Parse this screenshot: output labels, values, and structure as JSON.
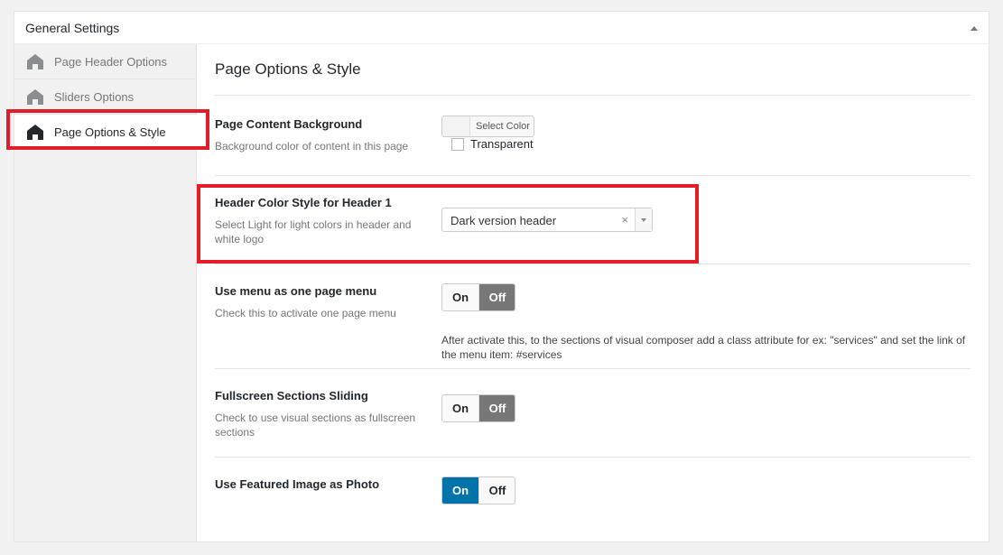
{
  "panel": {
    "title": "General Settings"
  },
  "sidebar": {
    "items": [
      {
        "label": "Page Header Options"
      },
      {
        "label": "Sliders Options"
      },
      {
        "label": "Page Options & Style"
      }
    ]
  },
  "content": {
    "title": "Page Options & Style",
    "background": {
      "title": "Page Content Background",
      "desc": "Background color of content in this page",
      "button_label": "Select Color",
      "transparent_label": "Transparent"
    },
    "header_color": {
      "title": "Header Color Style for Header 1",
      "desc": "Select Light for light colors in header and white logo",
      "selected": "Dark version header",
      "clear": "×"
    },
    "one_page_menu": {
      "title": "Use menu as one page menu",
      "desc": "Check this to activate one page menu",
      "on": "On",
      "off": "Off",
      "note": "After activate this, to the sections of visual composer add a class attribute for ex: \"services\" and set the link of the menu item: #services"
    },
    "fullscreen": {
      "title": "Fullscreen Sections Sliding",
      "desc": "Check to use visual sections as fullscreen sections",
      "on": "On",
      "off": "Off"
    },
    "featured_image": {
      "title": "Use Featured Image as Photo",
      "on": "On",
      "off": "Off"
    }
  },
  "colors": {
    "highlight": "#e11d2a",
    "switch_on_active": "#0073aa",
    "switch_off_active": "#777777"
  }
}
